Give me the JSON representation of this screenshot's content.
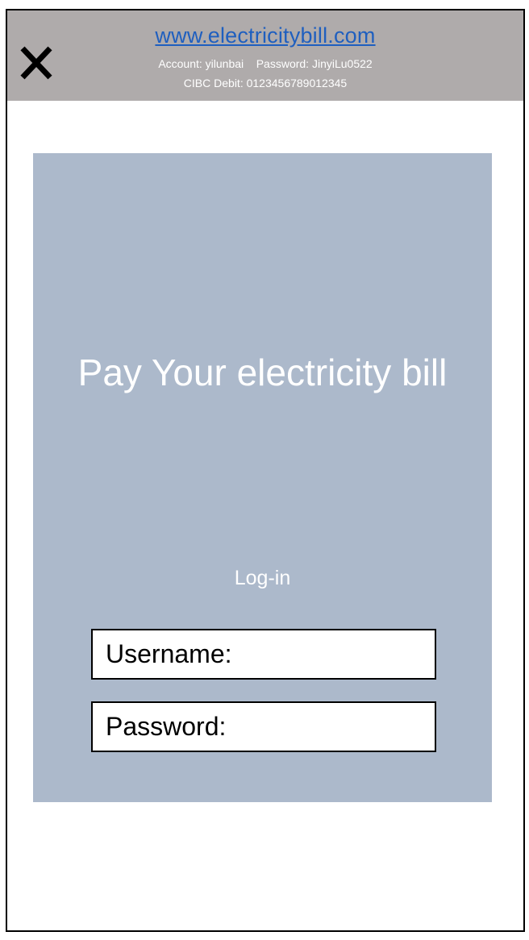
{
  "header": {
    "url": "www.electricitybill.com",
    "credentials_line": "Account: yilunbai    Password: JinyiLu0522",
    "debit_line": "CIBC Debit: 0123456789012345",
    "close_icon": "close-x-icon",
    "background_color": "#afabab",
    "url_color": "#1f5fbf"
  },
  "main": {
    "title": "Pay Your electricity bill",
    "login_label": "Log-in",
    "panel_color": "#acb9cb",
    "fields": {
      "username_label": "Username:",
      "password_label": "Password:"
    }
  }
}
